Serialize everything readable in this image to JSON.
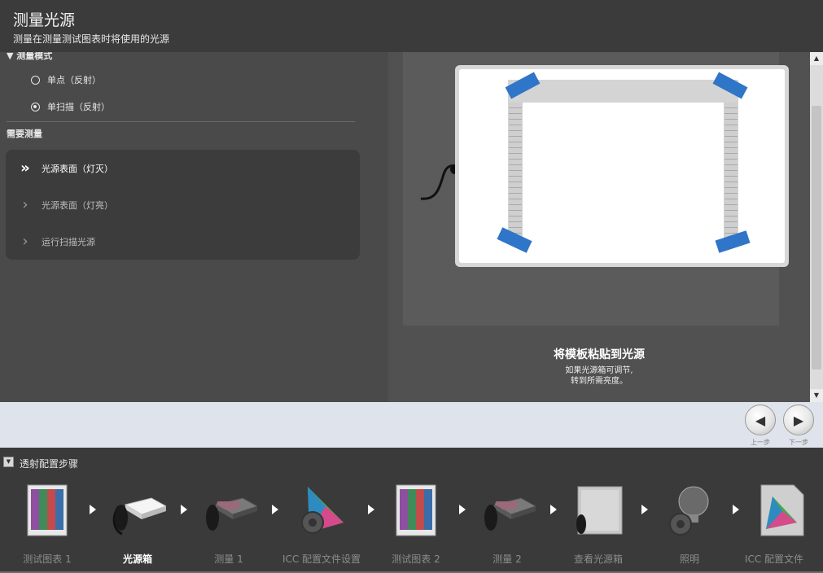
{
  "header": {
    "title": "测量光源",
    "subtitle": "测量在测量测试图表时将使用的光源"
  },
  "measure_mode": {
    "heading": "▼ 测量模式",
    "options": [
      {
        "label": "单点（反射）",
        "selected": false
      },
      {
        "label": "单扫描（反射）",
        "selected": true
      }
    ]
  },
  "required": {
    "heading": "需要测量",
    "steps": [
      {
        "label": "光源表面（灯灭）",
        "icon": "double-chevron-right-icon",
        "active": true
      },
      {
        "label": "光源表面（灯亮）",
        "icon": "chevron-right-icon",
        "active": false
      },
      {
        "label": "运行扫描光源",
        "icon": "chevron-right-icon",
        "active": false
      }
    ]
  },
  "illustration": {
    "caption_title": "将模板粘贴到光源",
    "caption_line1": "如果光源箱可调节,",
    "caption_line2": "转到所需亮度。",
    "tape_color": "#2f75c8"
  },
  "nav": {
    "prev_label": "上一步",
    "next_label": "下一步"
  },
  "workflow": {
    "title": "透射配置步骤",
    "steps": [
      {
        "label": "测试图表 1",
        "icon": "test-chart-icon",
        "active": false
      },
      {
        "label": "光源箱",
        "icon": "lightbox-device-icon",
        "active": true
      },
      {
        "label": "测量 1",
        "icon": "measure-device-icon",
        "active": false
      },
      {
        "label": "ICC 配置文件设置",
        "icon": "gamut-gear-icon",
        "active": false
      },
      {
        "label": "测试图表 2",
        "icon": "test-chart-icon",
        "active": false
      },
      {
        "label": "测量 2",
        "icon": "measure-device-icon",
        "active": false
      },
      {
        "label": "查看光源箱",
        "icon": "lightbox-view-icon",
        "active": false
      },
      {
        "label": "照明",
        "icon": "bulb-gear-icon",
        "active": false
      },
      {
        "label": "ICC 配置文件",
        "icon": "icc-profile-icon",
        "active": false
      }
    ]
  },
  "colors": {
    "accent_tape": "#2f75c8",
    "nav_bar": "#dfe4ec",
    "panel_dark": "#3a3a3a"
  }
}
